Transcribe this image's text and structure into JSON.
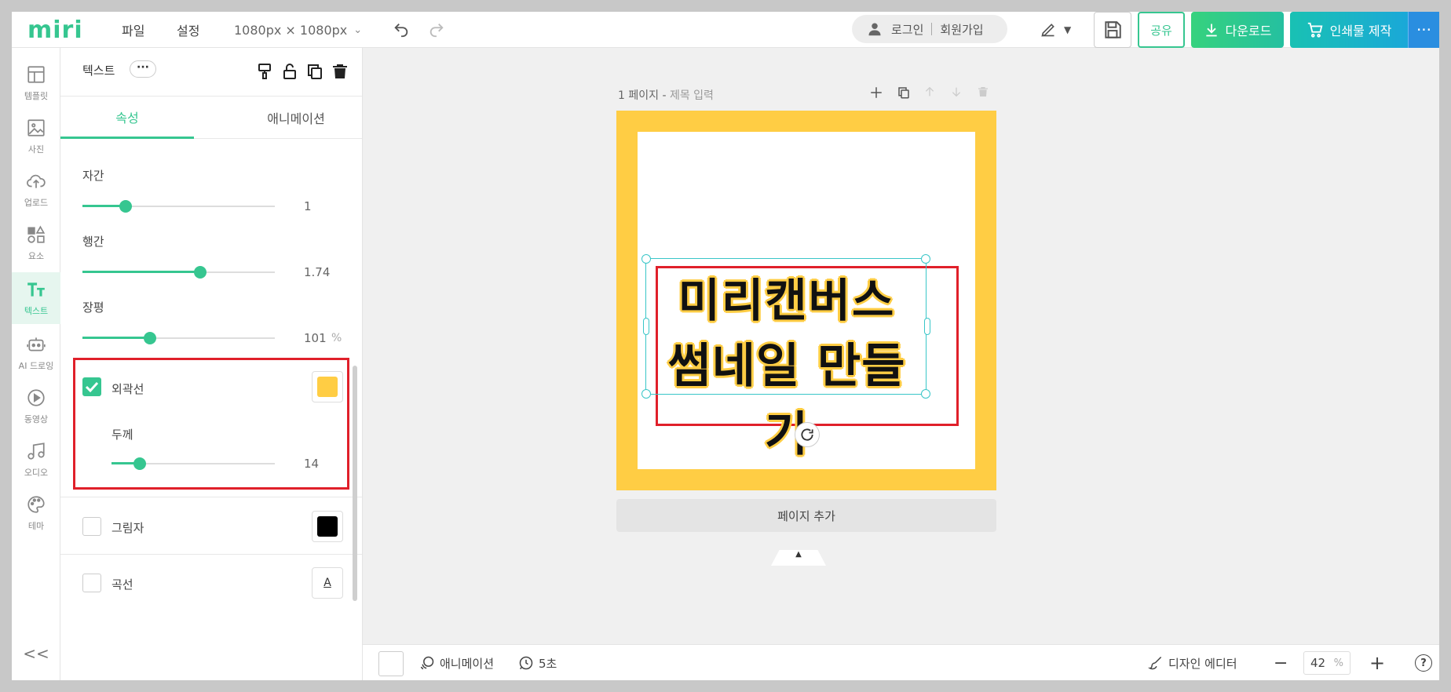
{
  "brand": {
    "logo": "miri"
  },
  "topbar": {
    "file": "파일",
    "settings": "설정",
    "canvas_size": "1080px × 1080px",
    "login": "로그인",
    "signup": "회원가입",
    "share": "공유",
    "download": "다운로드",
    "print": "인쇄물 제작",
    "more": "···"
  },
  "rail": {
    "items": [
      {
        "label": "템플릿",
        "icon": "template-icon"
      },
      {
        "label": "사진",
        "icon": "photo-icon"
      },
      {
        "label": "업로드",
        "icon": "upload-icon"
      },
      {
        "label": "요소",
        "icon": "elements-icon"
      },
      {
        "label": "텍스트",
        "icon": "text-icon",
        "active": true
      },
      {
        "label": "AI 드로잉",
        "icon": "ai-drawing-icon"
      },
      {
        "label": "동영상",
        "icon": "video-icon"
      },
      {
        "label": "오디오",
        "icon": "audio-icon"
      },
      {
        "label": "테마",
        "icon": "theme-icon"
      }
    ],
    "collapse": "<<"
  },
  "panel": {
    "title": "텍스트",
    "dots": "···",
    "tabs": {
      "properties": "속성",
      "animation": "애니메이션"
    },
    "spacing": {
      "label": "자간",
      "value": "1",
      "level": 0.25
    },
    "line_height": {
      "label": "행간",
      "value": "1.74",
      "level": 0.6
    },
    "width_ratio": {
      "label": "장평",
      "value": "101",
      "unit": "%",
      "level": 0.35
    },
    "outline": {
      "label": "외곽선",
      "checked": true,
      "color": "#ffcd44"
    },
    "thickness": {
      "label": "두께",
      "value": "14",
      "level": 0.17
    },
    "shadow": {
      "label": "그림자",
      "checked": false,
      "color": "#000000"
    },
    "curve": {
      "label": "곡선",
      "checked": false,
      "icon_text": "A"
    }
  },
  "canvas": {
    "page_number": "1 페이지",
    "page_dash": " - ",
    "page_title_placeholder": "제목 입력",
    "text_line1": "미리캔버스",
    "text_line2": "썸네일 만들기",
    "border_color": "#ffcd44",
    "add_page": "페이지 추가"
  },
  "bottombar": {
    "animation": "애니메이션",
    "duration": "5초",
    "design_editor": "디자인 에디터",
    "zoom": "42",
    "zoom_unit": "%",
    "help": "?"
  },
  "colors": {
    "accent": "#36c690",
    "highlight": "#e0202a",
    "selection": "#39c6c8"
  }
}
